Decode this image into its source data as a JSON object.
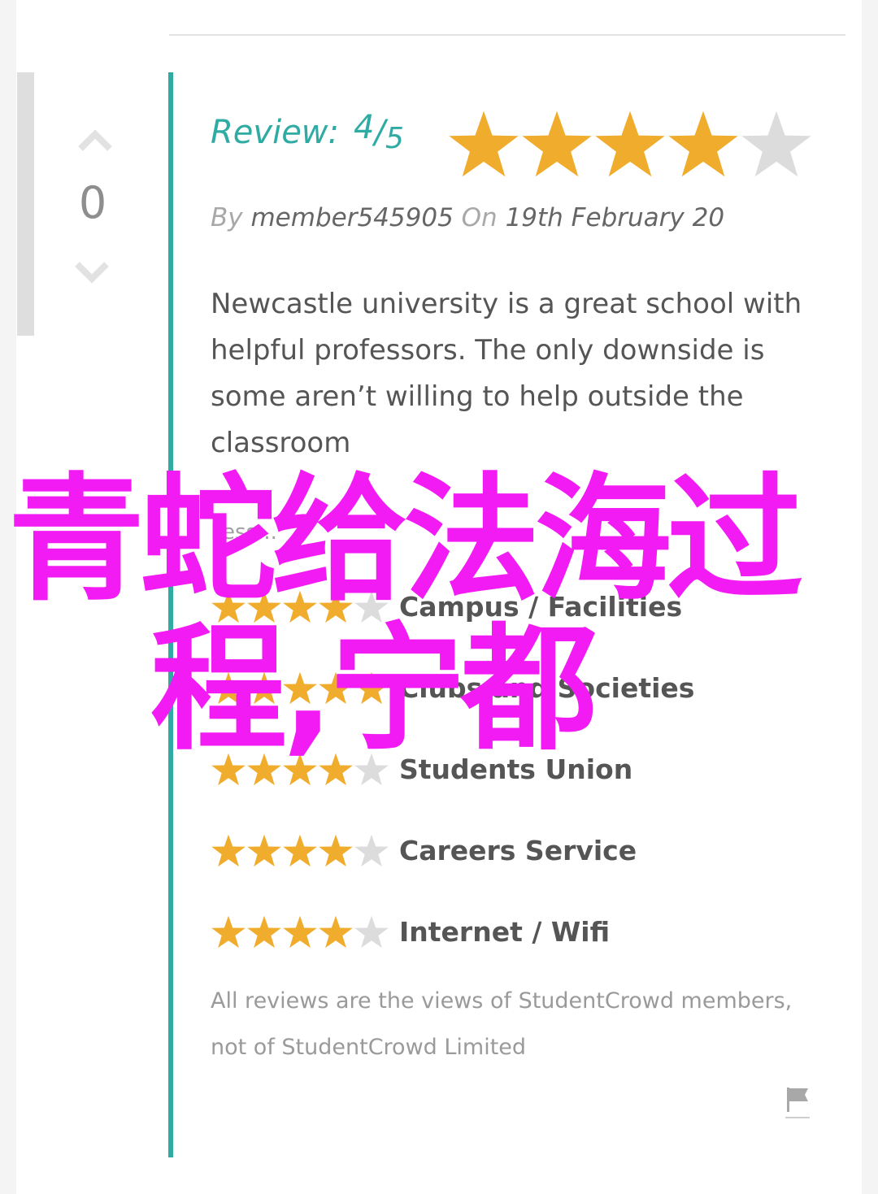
{
  "votes": {
    "count": "0"
  },
  "review": {
    "label": "Review:",
    "score": "4",
    "slash": "/",
    "out_of": "5",
    "rating": 4,
    "max": 5
  },
  "byline": {
    "by": "By",
    "author": "member545905",
    "on": "On",
    "date": "19th February 20"
  },
  "body": "Newcastle university is a great school with helpful professors. The only downside is some aren’t willing to help outside the classroom",
  "more_link": "Less...",
  "ratings": [
    {
      "label": "Campus / Facilities",
      "stars": 4
    },
    {
      "label": "Clubs and Societies",
      "stars": 5
    },
    {
      "label": "Students Union",
      "stars": 4
    },
    {
      "label": "Careers Service",
      "stars": 4
    },
    {
      "label": "Internet / Wifi",
      "stars": 4
    }
  ],
  "disclaimer": "All reviews are the views of StudentCrowd members, not of StudentCrowd Limited",
  "overlay": {
    "line1": "青蛇给法海过",
    "line2": "程,宁都"
  },
  "colors": {
    "accent": "#2eaba3",
    "star_on": "#f0ac2c",
    "star_off": "#dcdcdc",
    "overlay": "#f31bf3"
  },
  "icons": {
    "vote_up": "chevron-up-icon",
    "vote_down": "chevron-down-icon",
    "flag": "flag-icon",
    "star": "star-icon"
  }
}
